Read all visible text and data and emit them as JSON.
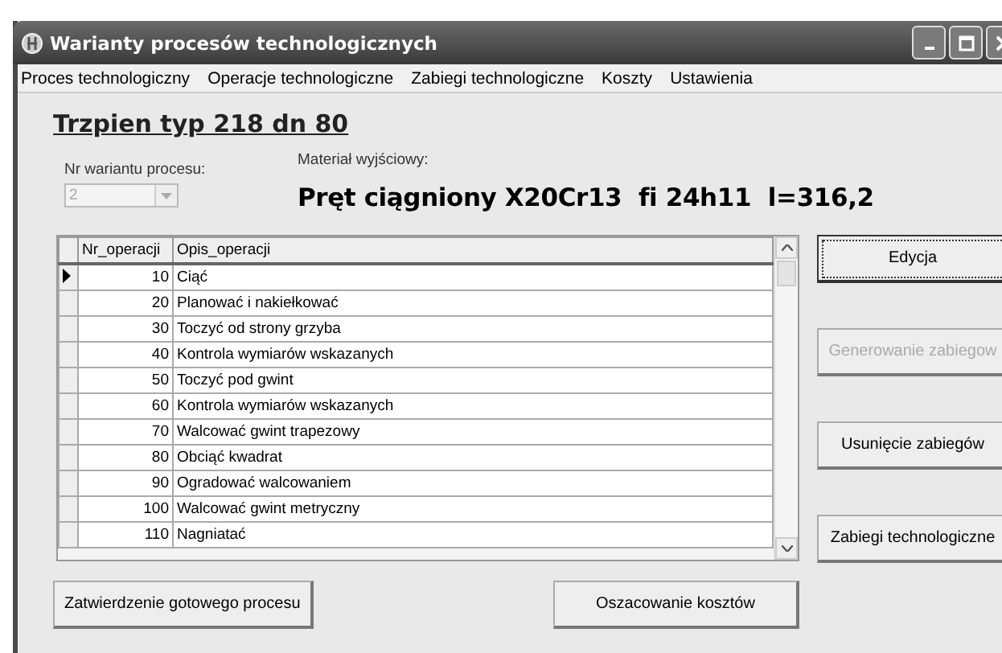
{
  "window": {
    "title": "Warianty procesów technologicznych"
  },
  "menu": [
    "Proces technologiczny",
    "Operacje technologiczne",
    "Zabiegi technologiczne",
    "Koszty",
    "Ustawienia"
  ],
  "heading": "Trzpien typ 218 dn 80",
  "variant": {
    "label": "Nr wariantu procesu:",
    "value": "2",
    "disabled": true
  },
  "material": {
    "label": "Materiał wyjściowy:",
    "value": "Pręt ciągniony X20Cr13  fi 24h11  l=316,2"
  },
  "table": {
    "columns": [
      "Nr_operacji",
      "Opis_operacji"
    ],
    "rows": [
      {
        "nr": "10",
        "opis": "Ciąć",
        "selected": true
      },
      {
        "nr": "20",
        "opis": "Planować i nakiełkować",
        "selected": false
      },
      {
        "nr": "30",
        "opis": "Toczyć od strony grzyba",
        "selected": false
      },
      {
        "nr": "40",
        "opis": "Kontrola wymiarów wskazanych",
        "selected": false
      },
      {
        "nr": "50",
        "opis": "Toczyć pod gwint",
        "selected": false
      },
      {
        "nr": "60",
        "opis": "Kontrola wymiarów wskazanych",
        "selected": false
      },
      {
        "nr": "70",
        "opis": "Walcować gwint trapezowy",
        "selected": false
      },
      {
        "nr": "80",
        "opis": "Obciąć kwadrat",
        "selected": false
      },
      {
        "nr": "90",
        "opis": "Ogradować walcowaniem",
        "selected": false
      },
      {
        "nr": "100",
        "opis": "Walcować gwint metryczny",
        "selected": false
      },
      {
        "nr": "110",
        "opis": "Nagniatać",
        "selected": false
      }
    ]
  },
  "side_buttons": [
    {
      "label": "Edycja",
      "disabled": false,
      "focused": true
    },
    {
      "label": "Generowanie zabiegow",
      "disabled": true,
      "focused": false
    },
    {
      "label": "Usunięcie zabiegów",
      "disabled": false,
      "focused": false
    },
    {
      "label": "Zabiegi technologiczne",
      "disabled": false,
      "focused": false
    }
  ],
  "bottom_buttons": [
    "Zatwierdzenie gotowego procesu",
    "Oszacowanie kosztów"
  ]
}
